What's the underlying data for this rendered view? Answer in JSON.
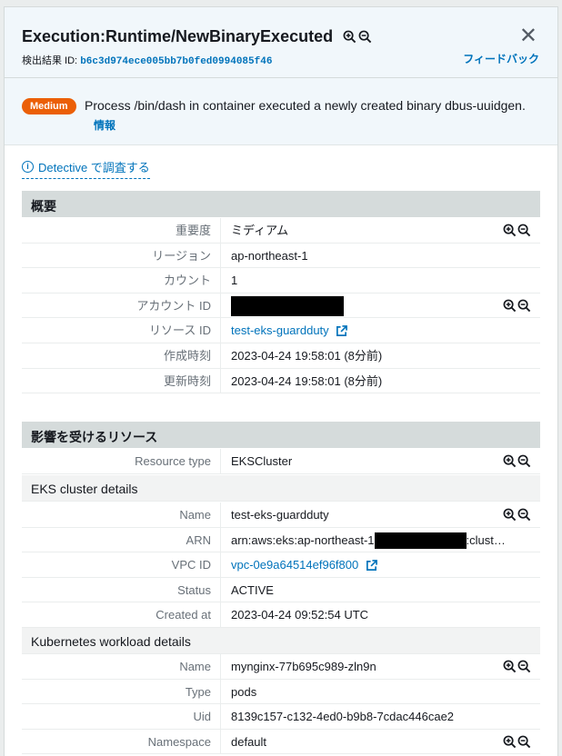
{
  "header": {
    "title": "Execution:Runtime/NewBinaryExecuted",
    "finding_id_label": "検出結果 ID:",
    "finding_id": "b6c3d974ece005bb7b0fed0994085f46",
    "feedback": "フィードバック"
  },
  "summary": {
    "severity_badge": "Medium",
    "text": "Process /bin/dash in container executed a newly created binary dbus-uuidgen.",
    "info_link": "情報"
  },
  "detective_link": "Detective で調査する",
  "overview": {
    "heading": "概要",
    "rows": [
      {
        "key": "重要度",
        "value": "ミディアム"
      },
      {
        "key": "リージョン",
        "value": "ap-northeast-1"
      },
      {
        "key": "カウント",
        "value": "1"
      },
      {
        "key": "アカウント ID",
        "value": ""
      },
      {
        "key": "リソース ID",
        "value": "test-eks-guardduty"
      },
      {
        "key": "作成時刻",
        "value": "2023-04-24 19:58:01 (8分前)"
      },
      {
        "key": "更新時刻",
        "value": "2023-04-24 19:58:01 (8分前)"
      }
    ]
  },
  "affected": {
    "heading": "影響を受けるリソース",
    "resource_type_key": "Resource type",
    "resource_type_value": "EKSCluster",
    "eks_heading": "EKS cluster details",
    "eks_rows": [
      {
        "key": "Name",
        "value": "test-eks-guardduty"
      },
      {
        "key": "ARN",
        "value_prefix": "arn:aws:eks:ap-northeast-1",
        "value_suffix": ":clust…"
      },
      {
        "key": "VPC ID",
        "value": "vpc-0e9a64514ef96f800"
      },
      {
        "key": "Status",
        "value": "ACTIVE"
      },
      {
        "key": "Created at",
        "value": "2023-04-24 09:52:54 UTC"
      }
    ],
    "k8s_heading": "Kubernetes workload details",
    "k8s_rows": [
      {
        "key": "Name",
        "value": "mynginx-77b695c989-zln9n"
      },
      {
        "key": "Type",
        "value": "pods"
      },
      {
        "key": "Uid",
        "value": "8139c157-c132-4ed0-b9b8-7cdac446cae2"
      },
      {
        "key": "Namespace",
        "value": "default"
      }
    ]
  },
  "colors": {
    "accent": "#0073bb",
    "severity_medium": "#eb5f07",
    "header_bg": "#f1f7fb",
    "section_bg": "#d5dbdb"
  }
}
